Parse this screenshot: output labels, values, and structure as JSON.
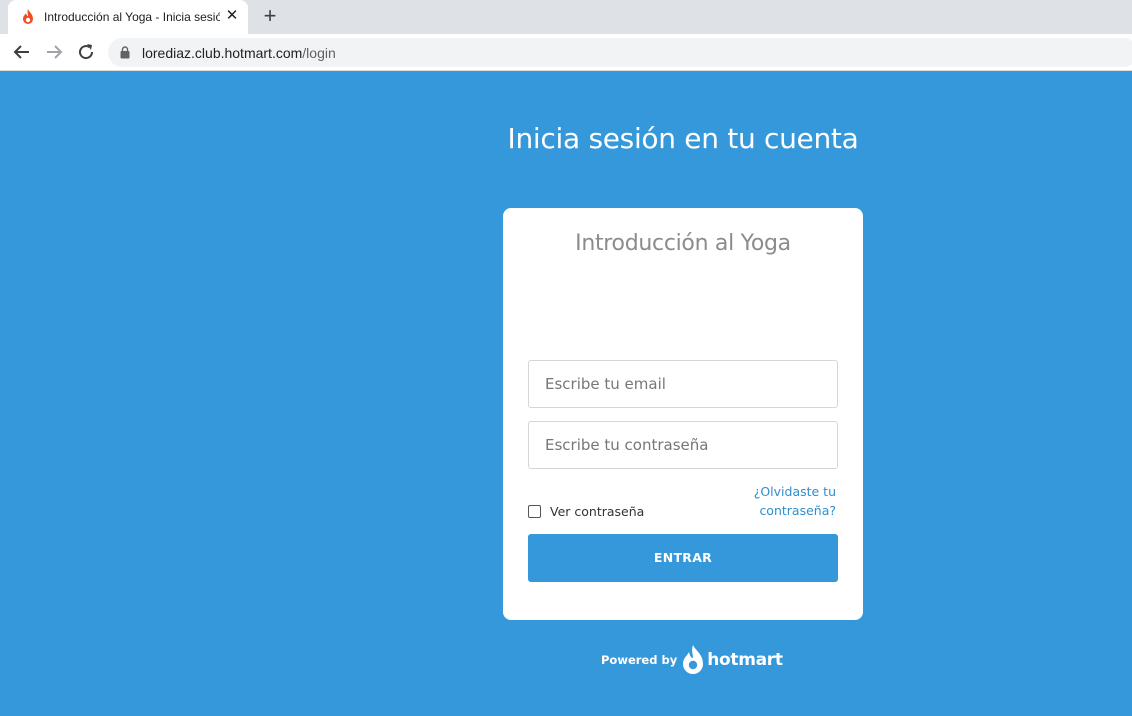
{
  "browser": {
    "tab_title": "Introducción al Yoga - Inicia sesión",
    "tab_close": "✕",
    "new_tab": "+",
    "url_host": "lorediaz.club.hotmart.com",
    "url_path": "/login"
  },
  "page": {
    "heading": "Inicia sesión en tu cuenta",
    "card_title": "Introducción al Yoga",
    "email_placeholder": "Escribe tu email",
    "password_placeholder": "Escribe tu contraseña",
    "show_password_label": "Ver contraseña",
    "show_password_checked": false,
    "forgot_link": "¿Olvidaste tu contraseña?",
    "submit_label": "ENTRAR",
    "powered_by": "Powered by",
    "brand_name": "hotmart"
  },
  "colors": {
    "background": "#3598db",
    "button": "#3598db",
    "link": "#2f8fd0",
    "favicon": "#ef4e23"
  },
  "icons": {
    "favicon": "hotmart-flame-icon",
    "back": "arrow-left-icon",
    "forward": "arrow-right-icon",
    "reload": "reload-icon",
    "lock": "lock-icon",
    "brand_logo": "hotmart-flame-icon"
  }
}
